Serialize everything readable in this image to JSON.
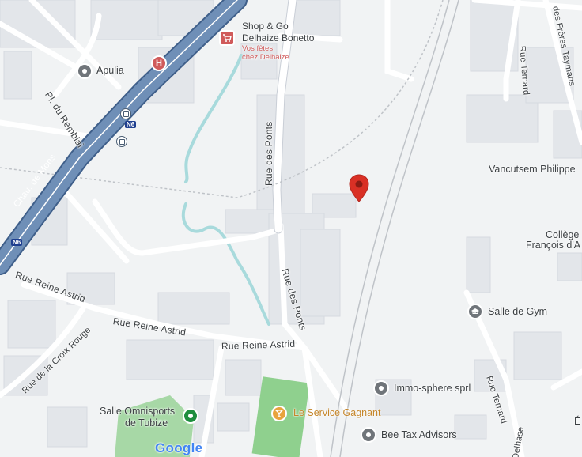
{
  "map": {
    "streets": {
      "chau_de_mons": "Chau. de Mons",
      "pl_du_remblai": "Pl. du Remblai",
      "rue_des_ponts_top": "Rue des Ponts",
      "rue_des_ponts_bottom": "Rue des Ponts",
      "rue_reine_astrid_1": "Rue Reine Astrid",
      "rue_reine_astrid_2": "Rue Reine Astrid",
      "rue_reine_astrid_3": "Rue Reine Astrid",
      "rue_de_la_croix_rouge": "Rue de la Croix Rouge",
      "rue_ternard_top": "Rue Ternard",
      "rue_ternard_bottom": "Rue Ternard",
      "rue_des_freres_taymans": "des Frères Taymans",
      "rue_delhase": "Delhase"
    },
    "highway_shields": [
      "N6",
      "N6"
    ],
    "places": {
      "apulia": "Apulia",
      "shop_go_line1": "Shop & Go",
      "shop_go_line2": "Delhaize Bonetto",
      "shop_go_sub1": "Vos fêtes",
      "shop_go_sub2": "chez Delhaize",
      "vancutsem": "Vancutsem Philippe",
      "college_line1": "Collège",
      "college_line2": "François d'A",
      "salle_de_gym": "Salle de Gym",
      "immo_sphere": "Immo-sphere sprl",
      "bee_tax": "Bee Tax Advisors",
      "le_service_gagnant": "Le Service Gagnant",
      "salle_omnisports_line1": "Salle Omnisports",
      "salle_omnisports_line2": "de Tubize",
      "edge_e": "É"
    },
    "hospital_letter": "H",
    "logo": "Google",
    "colors": {
      "land": "#f1f3f4",
      "building": "#e3e6ea",
      "road": "#ffffff",
      "major_road": "#5c7fa8",
      "water": "#a8dadc",
      "park": "#9bd39c",
      "marker": "#d93025",
      "poi_gray": "#70757a",
      "poi_green": "#1e8e3e",
      "poi_orange": "#e8a33d",
      "poi_red": "#d05a5a"
    }
  }
}
